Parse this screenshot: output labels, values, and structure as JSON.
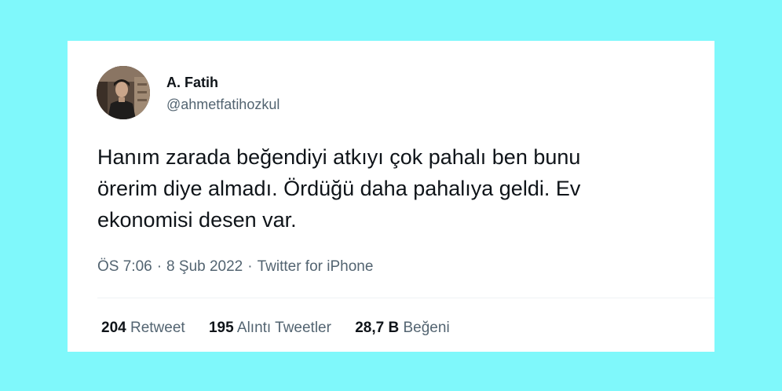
{
  "tweet": {
    "author_name": "A. Fatih",
    "handle": "@ahmetfatihozkul",
    "text": "Hanım zarada beğendiyi atkıyı çok pahalı ben bunu\nörerim diye almadı. Ördüğü daha pahalıya geldi. Ev\nekonomisi desen var.",
    "time": "ÖS 7:06",
    "date": "8 Şub 2022",
    "separator": "·",
    "source": "Twitter for iPhone"
  },
  "stats": {
    "retweets_count": "204",
    "retweets_label": "Retweet",
    "quotes_count": "195",
    "quotes_label": "Alıntı Tweetler",
    "likes_count": "28,7 B",
    "likes_label": "Beğeni"
  },
  "colors": {
    "page_background": "#7ff8fb",
    "card_background": "#ffffff",
    "text_primary": "#0f1419",
    "text_secondary": "#536471"
  }
}
